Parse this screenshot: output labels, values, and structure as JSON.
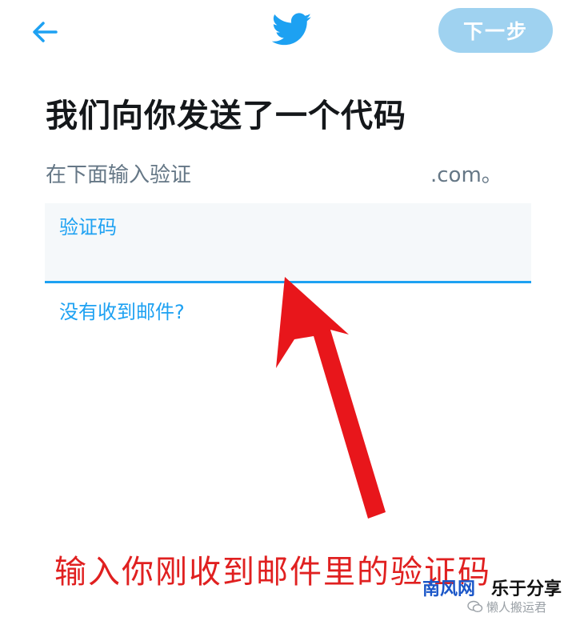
{
  "header": {
    "back_icon": "arrow-left-icon",
    "logo_icon": "twitter-bird-icon",
    "next_label": "下一步",
    "accent_color": "#1da1f2",
    "next_button_color": "#9fd2f0"
  },
  "main": {
    "title": "我们向你发送了一个代码",
    "subtitle": "在下面输入验证",
    "subtitle_domain": ".com。",
    "code_field": {
      "label": "验证码",
      "value": ""
    },
    "no_email_link": "没有收到邮件?"
  },
  "annotation": {
    "arrow_icon": "red-arrow-up-icon",
    "arrow_color": "#e8161b",
    "caption": "输入你刚收到邮件里的验证码"
  },
  "watermark": {
    "brand": "南风网",
    "brand_suffix": "乐于分享",
    "sub": "懒人搬运君"
  }
}
